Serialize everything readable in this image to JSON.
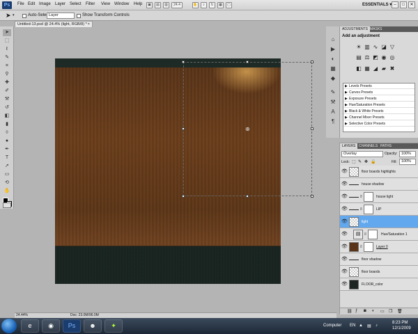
{
  "menubar": {
    "logo": "Ps",
    "items": [
      "File",
      "Edit",
      "Image",
      "Layer",
      "Select",
      "Filter",
      "View",
      "Window",
      "Help"
    ],
    "zoom": "24.4",
    "workspace": "ESSENTIALS ▾",
    "window_buttons": [
      "–",
      "□",
      "✕"
    ]
  },
  "options": {
    "auto_select_label": "Auto-Select:",
    "auto_select_value": "Layer",
    "show_transform_label": "Show Transform Controls"
  },
  "document": {
    "tab_title": "Untitled-13.psd @ 24.4% (light, RGB/8) *",
    "close_glyph": "×"
  },
  "status": {
    "zoom": "24.44%",
    "doc_size": "Doc: 23.0M/96.0M"
  },
  "adjustments": {
    "tabs": [
      "ADJUSTMENTS",
      "MASKS"
    ],
    "title": "Add an adjustment",
    "presets": [
      "Levels Presets",
      "Curves Presets",
      "Exposure Presets",
      "Hue/Saturation Presets",
      "Black & White Presets",
      "Channel Mixer Presets",
      "Selective Color Presets"
    ]
  },
  "layers": {
    "tabs": [
      "LAYERS",
      "CHANNELS",
      "PATHS"
    ],
    "blend_mode": "Overlay",
    "opacity_label": "Opacity:",
    "opacity_value": "100%",
    "lock_label": "Lock:",
    "fill_label": "Fill:",
    "fill_value": "100%",
    "rows": [
      "floor boards highlights",
      "house shadow",
      "house  light",
      "LIP",
      "light",
      "Hue/Saturation 1",
      "Layer 0",
      "floor shadow",
      "floor boards",
      "FLOOR_color"
    ]
  },
  "taskbar": {
    "computer_label": "Computer",
    "lang": "EN",
    "time": "8:23 PM",
    "date": "12/1/2009"
  },
  "colors": {
    "selection": "#62a8ee",
    "wood": "#6b3e1b",
    "floor": "#1c2824"
  }
}
